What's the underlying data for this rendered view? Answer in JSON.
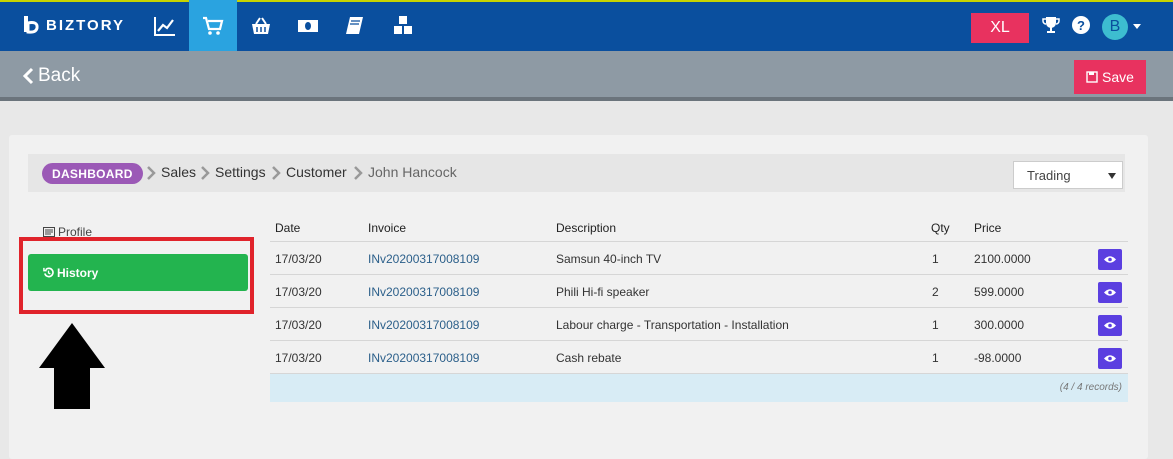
{
  "app": {
    "brand": "BIZTORY",
    "accent": "#0a4f9e",
    "active_tab_color": "#2aa3e0"
  },
  "nav": {
    "icons": [
      "chart-line-icon",
      "cart-icon",
      "basket-icon",
      "money-icon",
      "book-icon",
      "cubes-icon"
    ],
    "active": "cart-icon",
    "xl_label": "XL",
    "avatar_letter": "B"
  },
  "subbar": {
    "back_label": "Back",
    "save_label": "Save"
  },
  "breadcrumb": {
    "dashboard": "DASHBOARD",
    "items": [
      "Sales",
      "Settings",
      "Customer"
    ],
    "current": "John Hancock"
  },
  "filter": {
    "selected": "Trading"
  },
  "sidenav": {
    "profile_label": "Profile",
    "history_label": "History"
  },
  "table": {
    "headers": [
      "Date",
      "Invoice",
      "Description",
      "Qty",
      "Price"
    ],
    "rows": [
      {
        "date": "17/03/20",
        "invoice": "INv20200317008109",
        "description": "Samsun 40-inch TV",
        "qty": "1",
        "price": "2100.0000"
      },
      {
        "date": "17/03/20",
        "invoice": "INv20200317008109",
        "description": "Phili Hi-fi speaker",
        "qty": "2",
        "price": "599.0000"
      },
      {
        "date": "17/03/20",
        "invoice": "INv20200317008109",
        "description": "Labour charge - Transportation - Installation",
        "qty": "1",
        "price": "300.0000"
      },
      {
        "date": "17/03/20",
        "invoice": "INv20200317008109",
        "description": "Cash rebate",
        "qty": "1",
        "price": "-98.0000"
      }
    ],
    "records": "(4 / 4 records)"
  }
}
